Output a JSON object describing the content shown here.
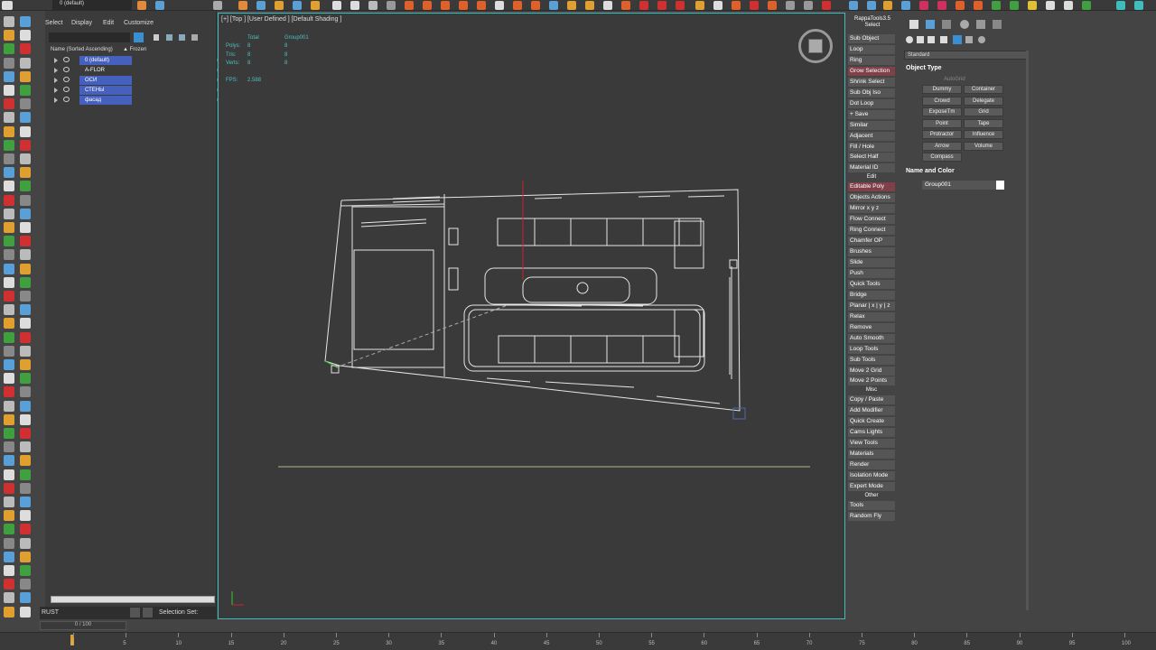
{
  "topbar": {
    "layer_dropdown": "0 (default)"
  },
  "scene_explorer": {
    "menu": [
      "Select",
      "Display",
      "Edit",
      "Customize"
    ],
    "header_name": "Name (Sorted Ascending)",
    "header_frozen": "▲ Frozen",
    "layers": [
      {
        "name": "0 (default)",
        "selected": true
      },
      {
        "name": "A-FLOR",
        "selected": false
      },
      {
        "name": "ОСИ",
        "selected": true
      },
      {
        "name": "СТЕНЫ",
        "selected": true
      },
      {
        "name": "фасад",
        "selected": true
      }
    ]
  },
  "bottom_left": {
    "workspace": "RUST",
    "selection_set_label": "Selection Set:",
    "frame_counter": "0 / 100"
  },
  "viewport": {
    "label": "[+] [Top ] [User Defined ] [Default Shading ]",
    "stats": {
      "headers": [
        "Total",
        "Group001"
      ],
      "rows": [
        {
          "label": "Polys:",
          "total": "8",
          "group": "8"
        },
        {
          "label": "Tris:",
          "total": "8",
          "group": "8"
        },
        {
          "label": "Verts:",
          "total": "8",
          "group": "8"
        }
      ],
      "fps_label": "FPS:",
      "fps_value": "2.588"
    }
  },
  "rappa": {
    "title": "RappaTools3.5",
    "subtitle": "Select",
    "buttons_select": [
      "Sub Object",
      "Loop",
      "Ring",
      "Grow Selection",
      "Shrink Select",
      "Sub Obj Iso",
      "Dot Loop",
      "+ Save",
      "Similar",
      "Adjacent",
      "Fill / Hole",
      "Select Half",
      "Material ID"
    ],
    "section_edit": "Edit",
    "buttons_edit": [
      "Editable Poly",
      "Objects Actions",
      "Mirror   x  y  z",
      "Flow Connect",
      "Ring Connect",
      "Chamfer OP",
      "Brushes",
      "Slide",
      "Push",
      "Quick Tools",
      "Bridge",
      "Planar | x | y | z",
      "Relax",
      "Remove",
      "Auto Smooth",
      "Loop Tools",
      "Sub Tools",
      "Move 2 Grid",
      "Move 2 Points"
    ],
    "section_misc": "Misc",
    "buttons_misc": [
      "Copy / Paste",
      "Add Modifier",
      "Quick Create",
      "Cams Lights",
      "View Tools",
      "Materials",
      "Render",
      "Isolation Mode",
      "Expert Mode"
    ],
    "section_other": "Other",
    "buttons_other": [
      "Tools",
      "Random Fly"
    ]
  },
  "command_panel": {
    "dropdown": "Standard",
    "object_type_title": "Object Type",
    "autogrid": "AutoGrid",
    "object_buttons": [
      "Dummy",
      "Container",
      "Crowd",
      "Delegate",
      "ExposeTm",
      "Grid",
      "Point",
      "Tape",
      "Protractor",
      "Influence",
      "Arrow",
      "Volume",
      "Compass"
    ],
    "name_color_title": "Name and Color",
    "object_name": "Group001",
    "object_color": "#ffffff"
  },
  "timeline": {
    "ticks": [
      "0",
      "5",
      "10",
      "15",
      "20",
      "25",
      "30",
      "35",
      "40",
      "45",
      "50",
      "55",
      "60",
      "65",
      "70",
      "75",
      "80",
      "85",
      "90",
      "95",
      "100"
    ]
  }
}
